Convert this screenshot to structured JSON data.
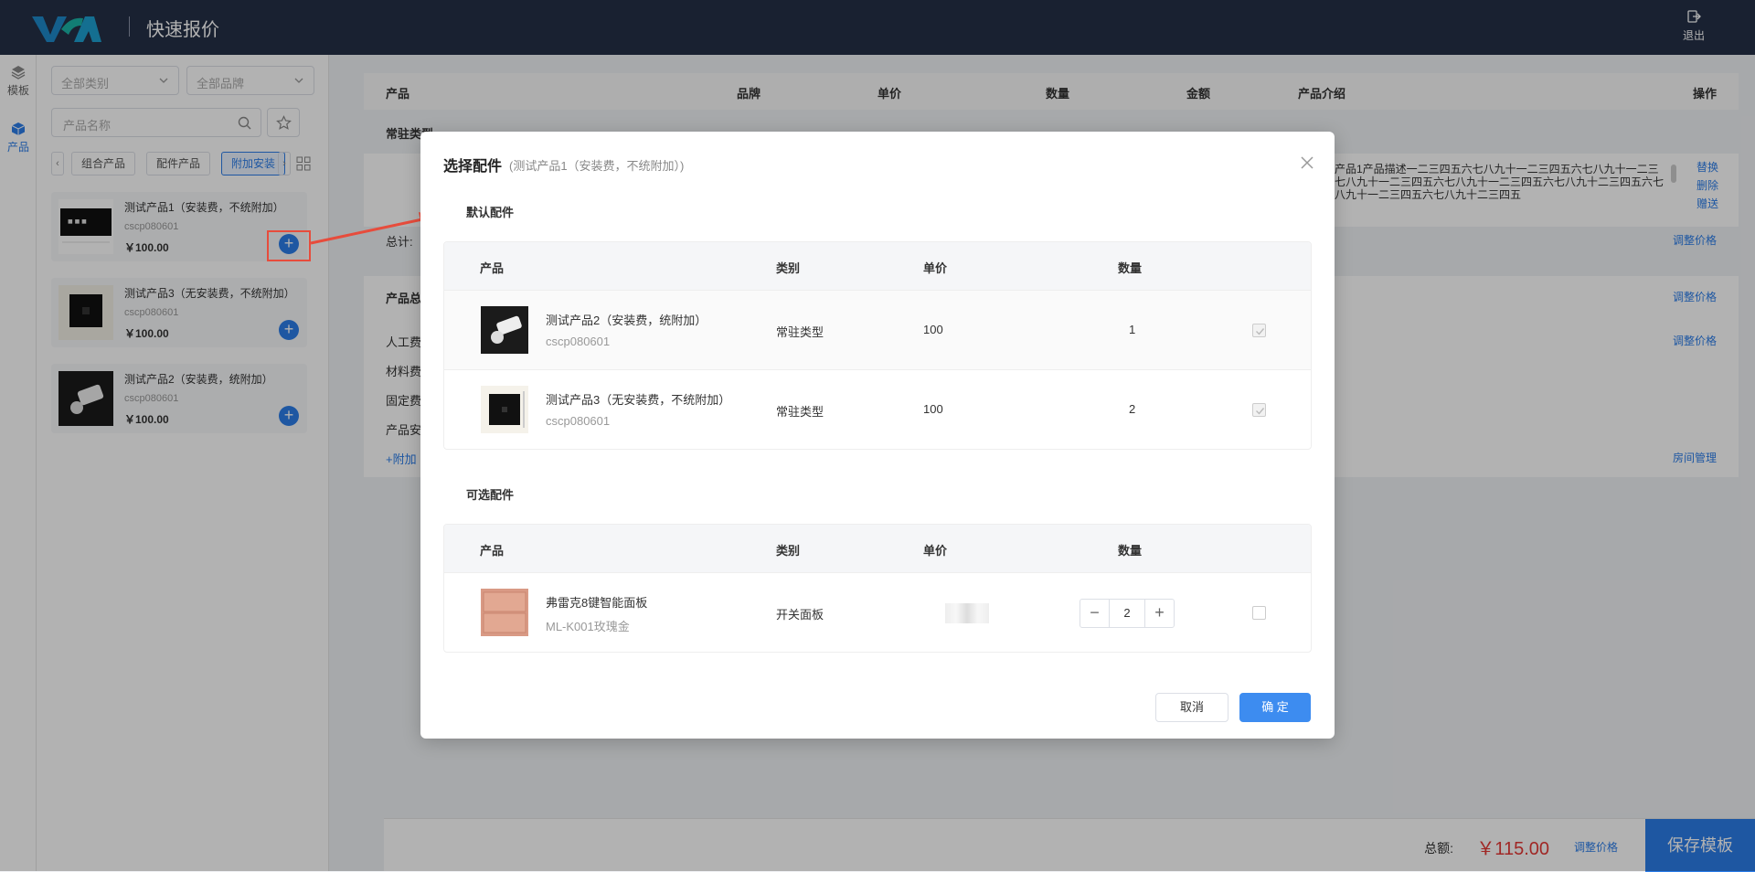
{
  "header": {
    "title": "快速报价",
    "logout_label": "退出"
  },
  "rail": {
    "items": [
      {
        "label": "模板"
      },
      {
        "label": "产品"
      }
    ]
  },
  "sidebar": {
    "category_select": "全部类别",
    "brand_select": "全部品牌",
    "search_placeholder": "产品名称",
    "tabs": [
      {
        "label": "组合产品"
      },
      {
        "label": "配件产品"
      },
      {
        "label": "附加安装"
      }
    ],
    "products": [
      {
        "name": "测试产品1（安装费，不统附加）",
        "code": "cscp080601",
        "price": "￥100.00"
      },
      {
        "name": "测试产品3（无安装费，不统附加）",
        "code": "cscp080601",
        "price": "￥100.00"
      },
      {
        "name": "测试产品2（安装费，统附加）",
        "code": "cscp080601",
        "price": "￥100.00"
      }
    ]
  },
  "main": {
    "columns": [
      "产品",
      "品牌",
      "单价",
      "数量",
      "金额",
      "产品介绍",
      "操作"
    ],
    "section": "常驻类型",
    "total_label": "总计:",
    "description": "产品1产品描述一二三四五六七八九十一二三四五六七八九十一二三七八九十一二三四五六七八九十一二三四五六七八九十二三四五六七八九十一二三四五六七八九十二三四五",
    "actions": [
      "替换",
      "删除",
      "赠送"
    ],
    "adjust_price": "调整价格",
    "summary_title": "产品总",
    "fee_rows": [
      "人工费",
      "材料费",
      "固定费",
      "产品安"
    ],
    "add_link": "+附加",
    "room_manage": "房间管理"
  },
  "footer": {
    "total_label": "总额:",
    "total_value": "￥115.00",
    "adjust_price": "调整价格",
    "save_label": "保存模板"
  },
  "modal": {
    "title": "选择配件",
    "subtitle": "(测试产品1（安装费，不统附加）)",
    "default_section": "默认配件",
    "optional_section": "可选配件",
    "columns": [
      "产品",
      "类别",
      "单价",
      "数量"
    ],
    "default_rows": [
      {
        "name": "测试产品2（安装费，统附加）",
        "code": "cscp080601",
        "category": "常驻类型",
        "price": "100",
        "qty": "1"
      },
      {
        "name": "测试产品3（无安装费，不统附加）",
        "code": "cscp080601",
        "category": "常驻类型",
        "price": "100",
        "qty": "2"
      }
    ],
    "optional_rows": [
      {
        "name": "弗雷克8键智能面板",
        "code": "ML-K001玫瑰金",
        "category": "开关面板",
        "qty": "2"
      }
    ],
    "cancel_label": "取消",
    "ok_label": "确 定"
  },
  "colors": {
    "header_bg": "#253047",
    "primary": "#2b7de9",
    "price_red": "#e53935",
    "annotation": "#e74c3c"
  }
}
